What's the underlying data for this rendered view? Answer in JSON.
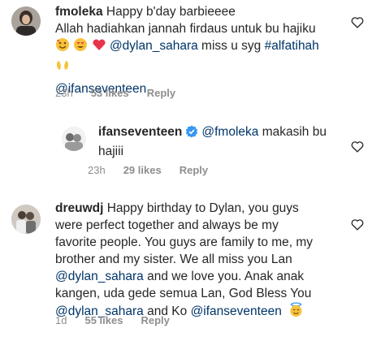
{
  "comments": [
    {
      "username": "fmoleka",
      "line1": "Happy b'day barbieeee",
      "line2": "Allah hadiahkan jannah firdaus untuk bu hajiku",
      "mention1": "@dylan_sahara",
      "text_after_mention1": " miss u syg ",
      "hashtag": "#alfatihah",
      "mention2": "@ifanseventeen",
      "time": "23h",
      "likes": "53 likes",
      "reply": "Reply",
      "emoji_names": [
        "smiling-face-with-hearts-emoji",
        "heart-eyes-emoji",
        "red-heart-emoji",
        "open-hands-emoji"
      ]
    },
    {
      "username": "ifanseventeen",
      "verified": true,
      "mention": "@fmoleka",
      "text_line1": " makasih bu",
      "text_line2": "hajiii",
      "time": "23h",
      "likes": "29 likes",
      "reply": "Reply"
    },
    {
      "username": "dreuwdj",
      "text_l1": "Happy birthday to Dylan, you guys",
      "text_l2": "were perfect together and always be my",
      "text_l3": "favorite people. You guys are family to me, my",
      "text_l4": "brother and my sister. We all miss you Lan",
      "mention_l5": "@dylan_sahara",
      "text_l5": " and we love you. Anak anak",
      "text_l6": "kangen, uda gede semua Lan, God Bless You",
      "mention_l7a": "@dylan_sahara",
      "text_l7": " and Ko ",
      "mention_l7b": "@ifanseventeen",
      "time": "1d",
      "likes": "55 likes",
      "reply": "Reply",
      "emoji_names": [
        "smiling-face-with-halo-emoji"
      ]
    }
  ],
  "colors": {
    "text": "#262626",
    "mention": "#003569",
    "meta": "#8e8e8e",
    "verified": "#3897f0"
  }
}
